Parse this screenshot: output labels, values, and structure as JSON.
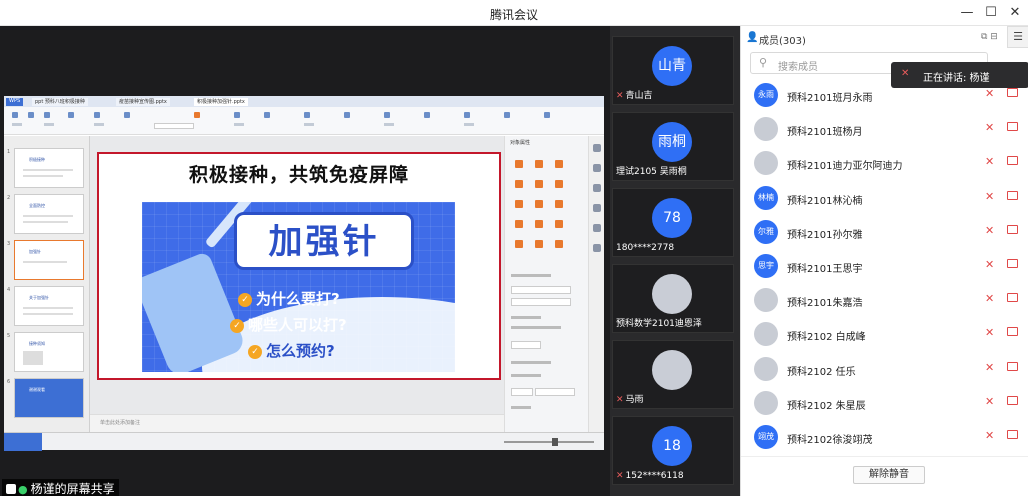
{
  "window": {
    "title": "腾讯会议",
    "minimize": "—",
    "maximize": "☐",
    "close": "✕"
  },
  "presentation": {
    "tabs": [
      "WPS",
      "ppt 预科八班积极接种",
      "疫苗接种宣传图.pptx",
      "积极接种加强针.pptx"
    ],
    "slide_title": "积极接种，共筑免疫屏障",
    "banner_headline": "加强针",
    "questions": [
      "为什么要打?",
      "哪些人可以打?",
      "怎么预约?"
    ],
    "thumbnails": [
      "1",
      "2",
      "3",
      "4",
      "5",
      "6"
    ],
    "thumb_titles": [
      "积极接种",
      "全面防控",
      "加强针",
      "关于加强针",
      "接种须知",
      "谢谢观看"
    ],
    "notes_placeholder": "单击此处添加备注",
    "properties_title": "对象属性"
  },
  "share_label": "杨谨的屏幕共享",
  "tiles": [
    {
      "avatar": "山青",
      "name": "青山吉",
      "photo": false
    },
    {
      "avatar": "雨桐",
      "name": "理试2105 吴雨桐",
      "photo": false
    },
    {
      "avatar": "78",
      "name": "180****2778",
      "photo": false
    },
    {
      "avatar": "",
      "name": "预科数学2101迪恩泽",
      "photo": true
    },
    {
      "avatar": "",
      "name": "马雨",
      "photo": true
    },
    {
      "avatar": "18",
      "name": "152****6118",
      "photo": false
    }
  ],
  "panel": {
    "title": "成员(303)",
    "search_placeholder": "搜索成员",
    "toast": "正在讲话: 杨谨",
    "unmute_all": "解除静音",
    "members": [
      {
        "avatar": "永雨",
        "name": "预科2101班月永雨",
        "photo": false
      },
      {
        "avatar": "",
        "name": "预科2101班杨月",
        "photo": true
      },
      {
        "avatar": "",
        "name": "预科2101迪力亚尔阿迪力",
        "photo": true
      },
      {
        "avatar": "林楠",
        "name": "预科2101林沁楠",
        "photo": false
      },
      {
        "avatar": "尔雅",
        "name": "预科2101孙尔雅",
        "photo": false
      },
      {
        "avatar": "思宇",
        "name": "预科2101王思宇",
        "photo": false
      },
      {
        "avatar": "",
        "name": "预科2101朱嘉浩",
        "photo": true
      },
      {
        "avatar": "",
        "name": "预科2102 白成峰",
        "photo": true
      },
      {
        "avatar": "",
        "name": "预科2102 任乐",
        "photo": true
      },
      {
        "avatar": "",
        "name": "预科2102 朱星辰",
        "photo": true
      },
      {
        "avatar": "翊茂",
        "name": "预科2102徐浚翊茂",
        "photo": false
      }
    ]
  },
  "colors": {
    "accent": "#2f6ff5",
    "muted": "#e04848",
    "slide_border": "#c3172b",
    "banner": "#3f6ce8"
  }
}
